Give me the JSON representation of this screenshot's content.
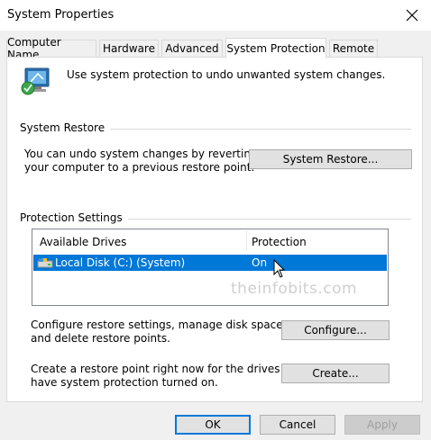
{
  "window": {
    "title": "System Properties",
    "close_icon": "close-icon"
  },
  "tabs": [
    {
      "label": "Computer Name"
    },
    {
      "label": "Hardware"
    },
    {
      "label": "Advanced"
    },
    {
      "label": "System Protection",
      "active": true
    },
    {
      "label": "Remote"
    }
  ],
  "intro": {
    "icon": "system-protection-icon",
    "text": "Use system protection to undo unwanted system changes."
  },
  "system_restore": {
    "group_label": "System Restore",
    "description_line1": "You can undo system changes by reverting",
    "description_line2": "your computer to a previous restore point.",
    "button_label": "System Restore..."
  },
  "protection_settings": {
    "group_label": "Protection Settings",
    "columns": [
      "Available Drives",
      "Protection"
    ],
    "drives": [
      {
        "name": "Local Disk (C:) (System)",
        "protection": "On",
        "icon": "drive-icon",
        "selected": true
      }
    ],
    "configure_text_line1": "Configure restore settings, manage disk space,",
    "configure_text_line2": "and delete restore points.",
    "configure_button": "Configure...",
    "create_text_line1": "Create a restore point right now for the drives that",
    "create_text_line2": "have system protection turned on.",
    "create_button": "Create..."
  },
  "watermark": "theinfobits.com",
  "footer": {
    "ok": "OK",
    "cancel": "Cancel",
    "apply": "Apply"
  },
  "colors": {
    "selection": "#0078d7",
    "default_button_border": "#0078d7"
  }
}
